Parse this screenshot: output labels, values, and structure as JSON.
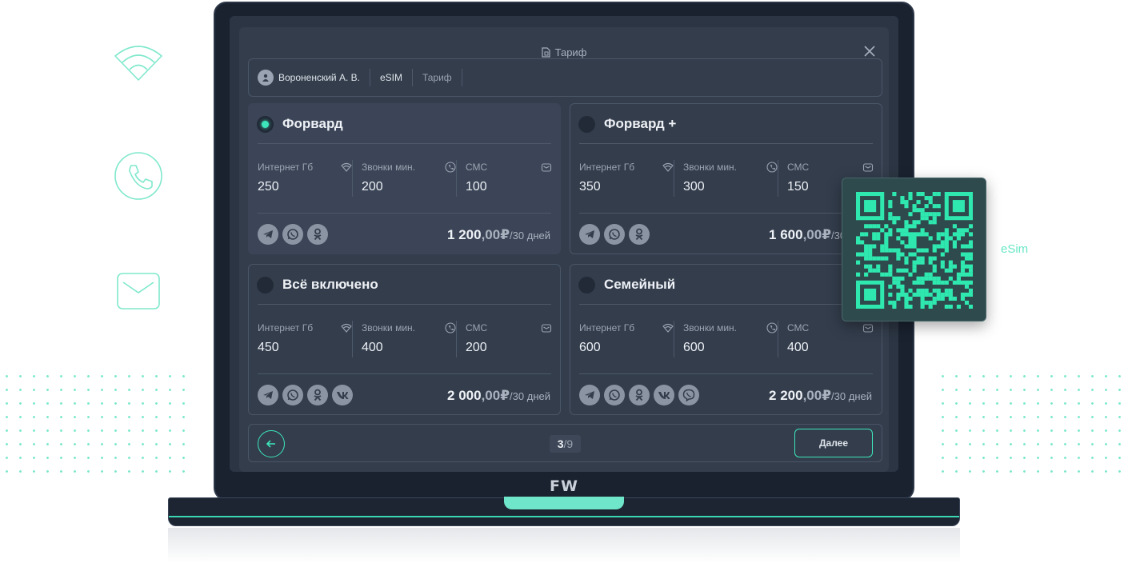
{
  "colors": {
    "accent": "#3ee6bb",
    "screen_bg": "#2c3543",
    "card_bg": "#333d4c",
    "selected_card_bg": "#3b4557"
  },
  "side_icons": [
    "wifi-icon",
    "phone-icon",
    "mail-icon"
  ],
  "dialog": {
    "title": "Тариф",
    "breadcrumb": {
      "user": "Вороненский А. В.",
      "type": "eSIM",
      "step": "Тариф"
    }
  },
  "plans": [
    {
      "name": "Форвард",
      "selected": true,
      "internet_label": "Интернет Гб",
      "internet": "250",
      "calls_label": "Звонки мин.",
      "calls": "200",
      "sms_label": "СМС",
      "sms": "100",
      "apps": [
        "telegram-icon",
        "whatsapp-icon",
        "odnoklassniki-icon"
      ],
      "price_main": "1 200",
      "price_cents": ",00",
      "currency": "₽",
      "period": "/30 дней"
    },
    {
      "name": "Форвард +",
      "selected": false,
      "internet_label": "Интернет Гб",
      "internet": "350",
      "calls_label": "Звонки мин.",
      "calls": "300",
      "sms_label": "СМС",
      "sms": "150",
      "apps": [
        "telegram-icon",
        "whatsapp-icon",
        "odnoklassniki-icon"
      ],
      "price_main": "1 600",
      "price_cents": ",00",
      "currency": "₽",
      "period": "/30 дней"
    },
    {
      "name": "Всё включено",
      "selected": false,
      "internet_label": "Интернет Гб",
      "internet": "450",
      "calls_label": "Звонки мин.",
      "calls": "400",
      "sms_label": "СМС",
      "sms": "200",
      "apps": [
        "telegram-icon",
        "whatsapp-icon",
        "odnoklassniki-icon",
        "vk-icon"
      ],
      "price_main": "2 000",
      "price_cents": ",00",
      "currency": "₽",
      "period": "/30 дней"
    },
    {
      "name": "Семейный",
      "selected": false,
      "internet_label": "Интернет Гб",
      "internet": "600",
      "calls_label": "Звонки мин.",
      "calls": "600",
      "sms_label": "СМС",
      "sms": "400",
      "apps": [
        "telegram-icon",
        "whatsapp-icon",
        "odnoklassniki-icon",
        "vk-icon",
        "viber-icon"
      ],
      "price_main": "2 200",
      "price_cents": ",00",
      "currency": "₽",
      "period": "/30 дней"
    }
  ],
  "footer": {
    "page_current": "3",
    "page_total": "/9",
    "next_label": "Далее"
  },
  "brand": "FW",
  "qr": {
    "label": "eSim"
  }
}
